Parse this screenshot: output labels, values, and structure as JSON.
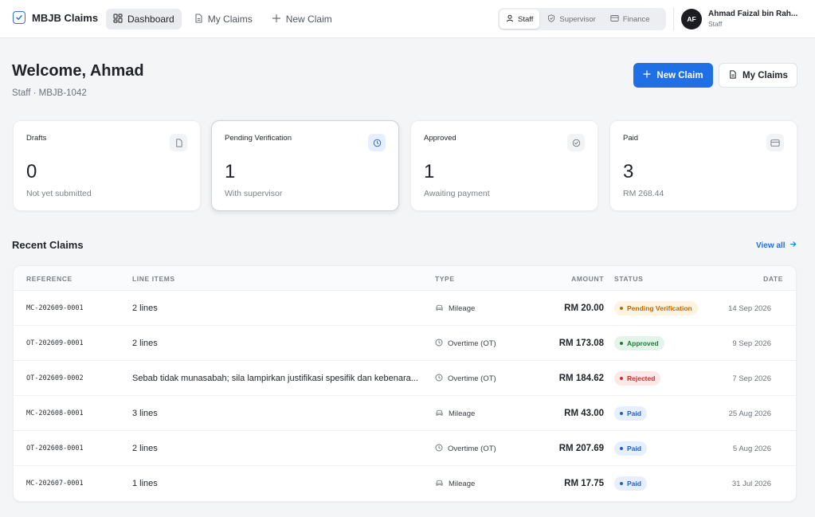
{
  "app": {
    "brand": "MBJB Claims"
  },
  "nav": [
    {
      "label": "Dashboard",
      "icon": "dashboard-icon",
      "active": true
    },
    {
      "label": "My Claims",
      "icon": "document-icon",
      "active": false
    },
    {
      "label": "New Claim",
      "icon": "plus-icon",
      "active": false
    }
  ],
  "roles": [
    {
      "label": "Staff",
      "icon": "user-icon",
      "active": true
    },
    {
      "label": "Supervisor",
      "icon": "shield-check-icon",
      "active": false
    },
    {
      "label": "Finance",
      "icon": "card-icon",
      "active": false
    }
  ],
  "user": {
    "initials": "AF",
    "name": "Ahmad Faizal bin Rah...",
    "role": "Staff"
  },
  "welcome": {
    "title": "Welcome, Ahmad",
    "subtitle": "Staff · MBJB-1042",
    "new_claim_label": "New Claim",
    "my_claims_label": "My Claims"
  },
  "cards": [
    {
      "label": "Drafts",
      "value": "0",
      "sub": "Not yet submitted",
      "icon": "document-icon"
    },
    {
      "label": "Pending Verification",
      "value": "1",
      "sub": "With supervisor",
      "icon": "clock-icon"
    },
    {
      "label": "Approved",
      "value": "1",
      "sub": "Awaiting payment",
      "icon": "check-circle-icon"
    },
    {
      "label": "Paid",
      "value": "3",
      "sub": "RM 268.44",
      "icon": "card-icon"
    }
  ],
  "recent": {
    "title": "Recent Claims",
    "view_all": "View all",
    "columns": {
      "reference": "REFERENCE",
      "line_items": "LINE ITEMS",
      "type": "TYPE",
      "amount": "AMOUNT",
      "status": "STATUS",
      "date": "DATE"
    },
    "rows": [
      {
        "ref": "MC-202609-0001",
        "lines": "2 lines",
        "type": "Mileage",
        "type_icon": "car-icon",
        "amount": "RM 20.00",
        "status": "Pending Verification",
        "status_kind": "pending",
        "date": "14 Sep 2026"
      },
      {
        "ref": "OT-202609-0001",
        "lines": "2 lines",
        "type": "Overtime (OT)",
        "type_icon": "clock-icon",
        "amount": "RM 173.08",
        "status": "Approved",
        "status_kind": "approved",
        "date": "9 Sep 2026"
      },
      {
        "ref": "OT-202609-0002",
        "lines": "Sebab tidak munasabah; sila lampirkan justifikasi spesifik dan kebenara...",
        "type": "Overtime (OT)",
        "type_icon": "clock-icon",
        "amount": "RM 184.62",
        "status": "Rejected",
        "status_kind": "rejected",
        "date": "7 Sep 2026"
      },
      {
        "ref": "MC-202608-0001",
        "lines": "3 lines",
        "type": "Mileage",
        "type_icon": "car-icon",
        "amount": "RM 43.00",
        "status": "Paid",
        "status_kind": "paid",
        "date": "25 Aug 2026"
      },
      {
        "ref": "OT-202608-0001",
        "lines": "2 lines",
        "type": "Overtime (OT)",
        "type_icon": "clock-icon",
        "amount": "RM 207.69",
        "status": "Paid",
        "status_kind": "paid",
        "date": "5 Aug 2026"
      },
      {
        "ref": "MC-202607-0001",
        "lines": "1 lines",
        "type": "Mileage",
        "type_icon": "car-icon",
        "amount": "RM 17.75",
        "status": "Paid",
        "status_kind": "paid",
        "date": "31 Jul 2026"
      }
    ]
  },
  "colors": {
    "accent": "#1f6fe5",
    "pending_bg": "#fdf3e1",
    "pending_fg": "#b86a0b",
    "approved_bg": "#e3f5e8",
    "approved_fg": "#1e7a3c",
    "rejected_bg": "#fde7e7",
    "rejected_fg": "#c23030",
    "paid_bg": "#e6efff",
    "paid_fg": "#1f5fc9"
  }
}
